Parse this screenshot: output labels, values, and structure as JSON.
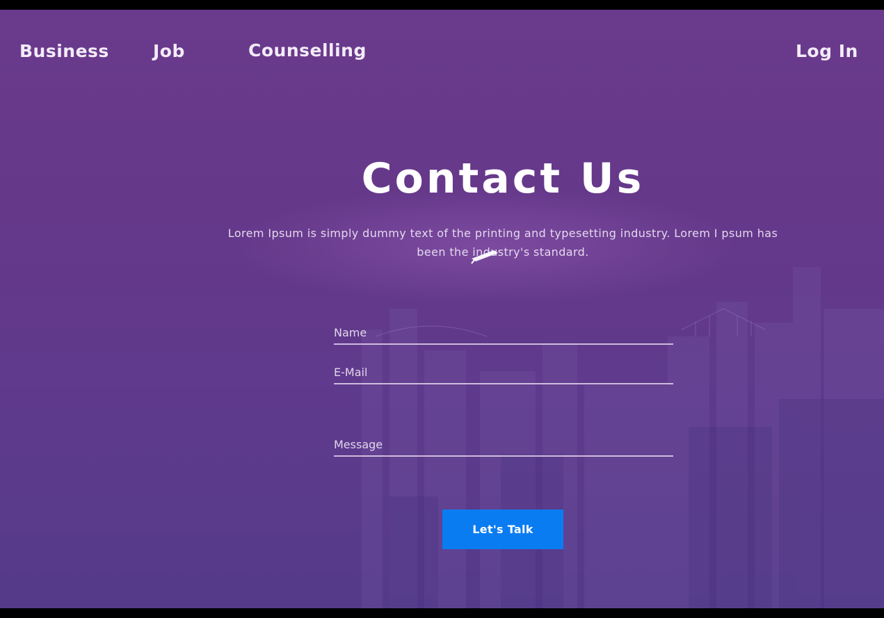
{
  "nav": {
    "items": [
      {
        "label": "Business"
      },
      {
        "label": "Job"
      },
      {
        "label": "Counselling"
      }
    ],
    "login_label": "Log In"
  },
  "hero": {
    "title": "Contact Us",
    "subtitle": "Lorem Ipsum is simply dummy text of the printing and typesetting industry. Lorem I psum has been the industry's standard."
  },
  "form": {
    "name_placeholder": "Name",
    "email_placeholder": "E-Mail",
    "message_placeholder": "Message",
    "submit_label": "Let's Talk"
  },
  "colors": {
    "background": "#66398b",
    "button": "#0a7cf2",
    "text": "#ffffff"
  },
  "icons": {
    "cursor": "mouse-pointer-icon"
  }
}
